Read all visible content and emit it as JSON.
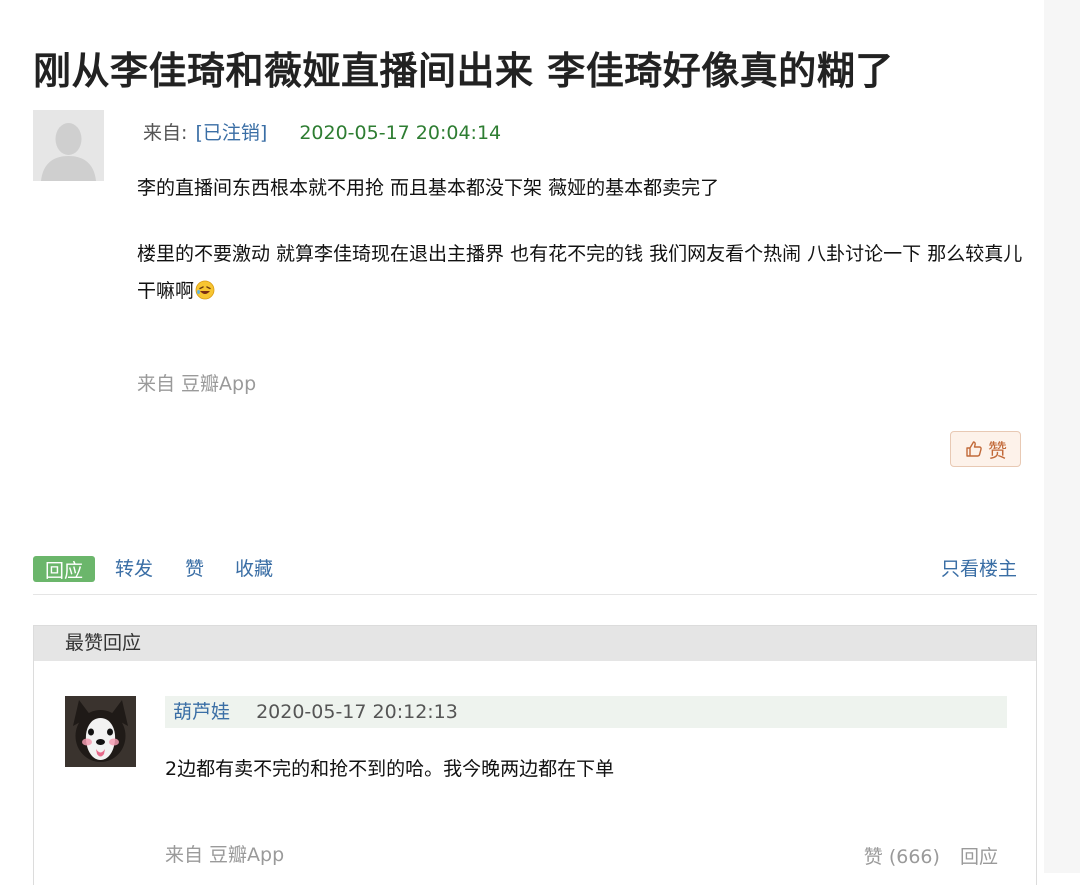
{
  "post": {
    "title": "刚从李佳琦和薇娅直播间出来 李佳琦好像真的糊了",
    "from_label": "来自:",
    "author": "[已注销]",
    "time": "2020-05-17 20:04:14",
    "paragraphs": [
      "李的直播间东西根本就不用抢 而且基本都没下架 薇娅的基本都卖完了",
      "楼里的不要激动 就算李佳琦现在退出主播界 也有花不完的钱 我们网友看个热闹 八卦讨论一下 那么较真儿干嘛啊"
    ],
    "source": "来自 豆瓣App",
    "like_label": "赞"
  },
  "actions": {
    "reply": "回应",
    "forward": "转发",
    "like": "赞",
    "collect": "收藏",
    "only_op": "只看楼主"
  },
  "best_replies": {
    "header": "最赞回应",
    "items": [
      {
        "author": "葫芦娃",
        "time": "2020-05-17 20:12:13",
        "text": "2边都有卖不完的和抢不到的哈。我今晚两边都在下单",
        "source": "来自 豆瓣App",
        "like_label": "赞 (666)",
        "reply_label": "回应"
      }
    ]
  },
  "icons": {
    "default_avatar": "user-silhouette-icon",
    "emoji": "rofl-emoji-icon",
    "like": "thumbs-up-icon"
  },
  "colors": {
    "link": "#3a6ea5",
    "time": "#2e7d32",
    "reply_button": "#6bb66b",
    "like_button_bg": "#fdf2ea"
  }
}
